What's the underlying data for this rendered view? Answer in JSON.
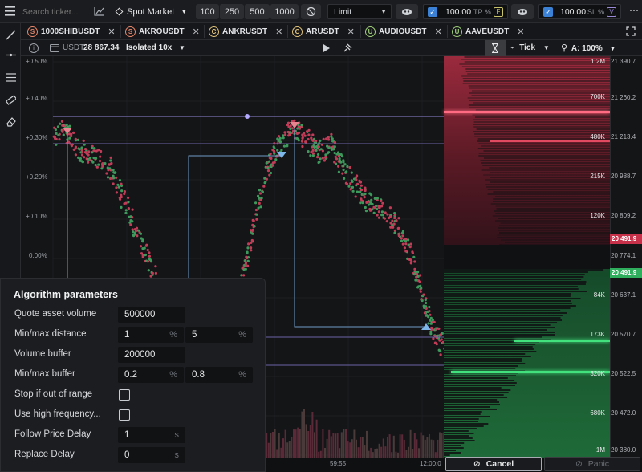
{
  "topbar": {
    "search_placeholder": "Search ticker...",
    "market_label": "Spot Market",
    "amount_buttons": [
      "100",
      "250",
      "500",
      "1000"
    ],
    "order_type": "Limit",
    "tp_value": "100.00",
    "tp_label": "TP %",
    "tp_badge": "F",
    "sl_value": "100.00",
    "sl_label": "SL %",
    "sl_badge": "V"
  },
  "tabs": [
    {
      "badge": "S",
      "label": "1000SHIBUSDT",
      "color": "#e8876a"
    },
    {
      "badge": "S",
      "label": "AKROUSDT",
      "color": "#e8876a"
    },
    {
      "badge": "C",
      "label": "ANKRUSDT",
      "color": "#e0c27a"
    },
    {
      "badge": "C",
      "label": "ARUSDT",
      "color": "#e0c27a"
    },
    {
      "badge": "U",
      "label": "AUDIOUSDT",
      "color": "#9fd07a"
    },
    {
      "badge": "U",
      "label": "AAVEUSDT",
      "color": "#9fd07a"
    }
  ],
  "subbar": {
    "balance_label": "USDT",
    "balance_value": "28 867.34",
    "margin_mode": "Isolated 10x",
    "interval": "Tick",
    "autoscale": "A: 100%"
  },
  "chart": {
    "y_labels": [
      "+0.50%",
      "+0.40%",
      "+0.30%",
      "+0.20%",
      "+0.10%",
      "0.00%"
    ],
    "x_labels": [
      "59:55",
      "12:00:0"
    ]
  },
  "orderbook": {
    "ask_volumes": [
      "1.2M",
      "700K",
      "480K",
      "215K",
      "120K"
    ],
    "bid_volumes": [
      "84K",
      "173K",
      "320K",
      "680K",
      "1M"
    ],
    "ask_prices": [
      "21 390.7",
      "21 260.2",
      "21 213.4",
      "20 988.7",
      "20 809.2"
    ],
    "best_ask": "20 491.9",
    "mid_price": "20 774.1",
    "best_bid": "20 491.9",
    "bid_prices": [
      "20 637.1",
      "20 570.7",
      "20 522.5",
      "20 472.0",
      "20 380.0"
    ],
    "colors": {
      "ask": "#c8314a",
      "bid": "#2fae5e"
    },
    "cancel_label": "Cancel",
    "panic_label": "Panic"
  },
  "algo": {
    "title": "Algorithm parameters",
    "quote_asset_volume_label": "Quote asset volume",
    "quote_asset_volume": "500000",
    "min_max_distance_label": "Min/max distance",
    "min_distance": "1",
    "max_distance": "5",
    "percent_unit": "%",
    "volume_buffer_label": "Volume buffer",
    "volume_buffer": "200000",
    "min_max_buffer_label": "Min/max buffer",
    "min_buffer": "0.2",
    "max_buffer": "0.8",
    "stop_out_of_range_label": "Stop if out of range",
    "use_high_freq_label": "Use high frequency...",
    "follow_price_delay_label": "Follow Price Delay",
    "follow_price_delay": "1",
    "replace_delay_label": "Replace Delay",
    "replace_delay": "0",
    "seconds_unit": "s"
  }
}
